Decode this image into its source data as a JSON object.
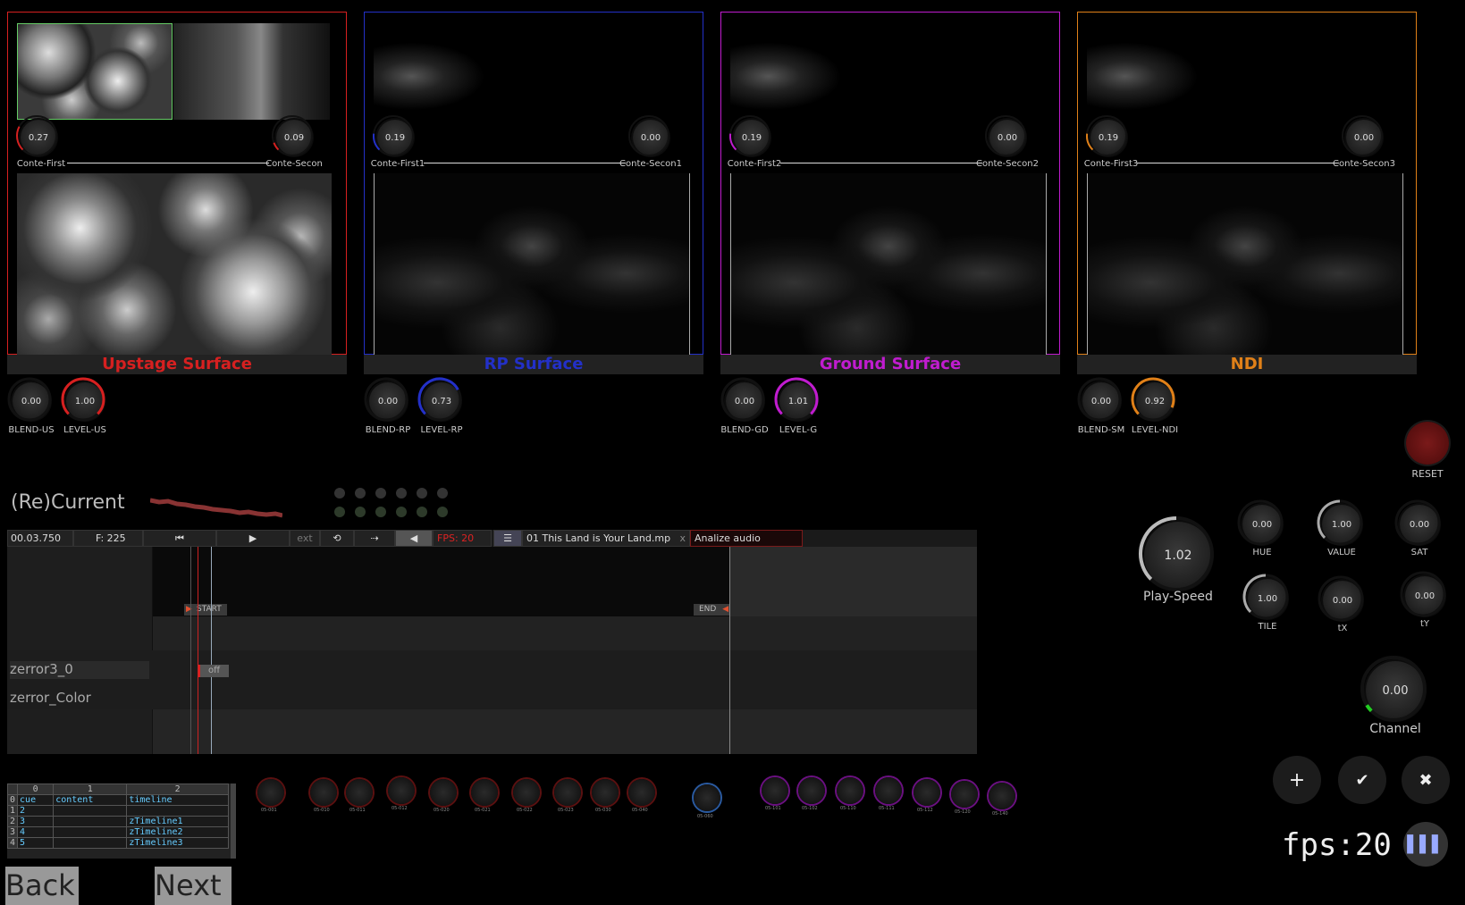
{
  "surfaces": [
    {
      "label": "Upstage Surface",
      "color": "#d62020",
      "k1": {
        "value": "0.27",
        "label": "Conte-First"
      },
      "k2": {
        "value": "0.09",
        "label": "Conte-Secon"
      },
      "blend": {
        "value": "0.00",
        "label": "BLEND-US"
      },
      "level": {
        "value": "1.00",
        "label": "LEVEL-US"
      }
    },
    {
      "label": "RP Surface",
      "color": "#2330c8",
      "k1": {
        "value": "0.19",
        "label": "Conte-First1"
      },
      "k2": {
        "value": "0.00",
        "label": "Conte-Secon1"
      },
      "blend": {
        "value": "0.00",
        "label": "BLEND-RP"
      },
      "level": {
        "value": "0.73",
        "label": "LEVEL-RP"
      }
    },
    {
      "label": "Ground Surface",
      "color": "#c01ccf",
      "k1": {
        "value": "0.19",
        "label": "Conte-First2"
      },
      "k2": {
        "value": "0.00",
        "label": "Conte-Secon2"
      },
      "blend": {
        "value": "0.00",
        "label": "BLEND-GD"
      },
      "level": {
        "value": "1.01",
        "label": "LEVEL-G"
      }
    },
    {
      "label": "NDI",
      "color": "#e08018",
      "k1": {
        "value": "0.19",
        "label": "Conte-First3"
      },
      "k2": {
        "value": "0.00",
        "label": "Conte-Secon3"
      },
      "blend": {
        "value": "0.00",
        "label": "BLEND-SM"
      },
      "level": {
        "value": "0.92",
        "label": "LEVEL-NDI"
      }
    }
  ],
  "reset": {
    "label": "RESET"
  },
  "app_title": "(Re)Current",
  "transport": {
    "timecode": "00.03.750",
    "frame": "F: 225",
    "ext": "ext",
    "fps": "FPS: 20",
    "file": "01 This Land is Your Land.mp",
    "analyze": "Analize audio",
    "close": "x"
  },
  "timeline": {
    "start": "START",
    "end": "END",
    "tracks": [
      "zerror3_0",
      "zerror_Color"
    ],
    "clip": "off"
  },
  "color_controls": {
    "play_speed": {
      "value": "1.02",
      "label": "Play-Speed"
    },
    "hue": {
      "value": "0.00",
      "label": "HUE"
    },
    "value": {
      "value": "1.00",
      "label": "VALUE"
    },
    "sat": {
      "value": "0.00",
      "label": "SAT"
    },
    "tile": {
      "value": "1.00",
      "label": "TILE"
    },
    "tx": {
      "value": "0.00",
      "label": "tX"
    },
    "ty": {
      "value": "0.00",
      "label": "tY"
    },
    "channel": {
      "value": "0.00",
      "label": "Channel"
    }
  },
  "fps": "fps:20",
  "icons": {
    "add": "+",
    "confirm": "✔",
    "cancel": "✖"
  },
  "sheet": {
    "columns": [
      "0",
      "1",
      "2"
    ],
    "rows": [
      {
        "idx": "0",
        "c0": "cue",
        "c1": "content",
        "c2": "timeline"
      },
      {
        "idx": "1",
        "c0": "2",
        "c1": "",
        "c2": ""
      },
      {
        "idx": "2",
        "c0": "3",
        "c1": "",
        "c2": "zTimeline1"
      },
      {
        "idx": "3",
        "c0": "4",
        "c1": "",
        "c2": "zTimeline2"
      },
      {
        "idx": "4",
        "c0": "5",
        "c1": "",
        "c2": "zTimeline3"
      }
    ]
  },
  "nav": {
    "back": "Back",
    "next": "Next"
  },
  "small_knobs": {
    "red": [
      "05-001",
      "05-010",
      "05-011",
      "05-012",
      "05-020",
      "05-021",
      "05-022",
      "05-023",
      "05-030",
      "05-040"
    ],
    "blue": [
      "05-060"
    ],
    "purple": [
      "05-101",
      "05-102",
      "05-110",
      "05-111",
      "05-112",
      "05-120",
      "05-140"
    ]
  }
}
